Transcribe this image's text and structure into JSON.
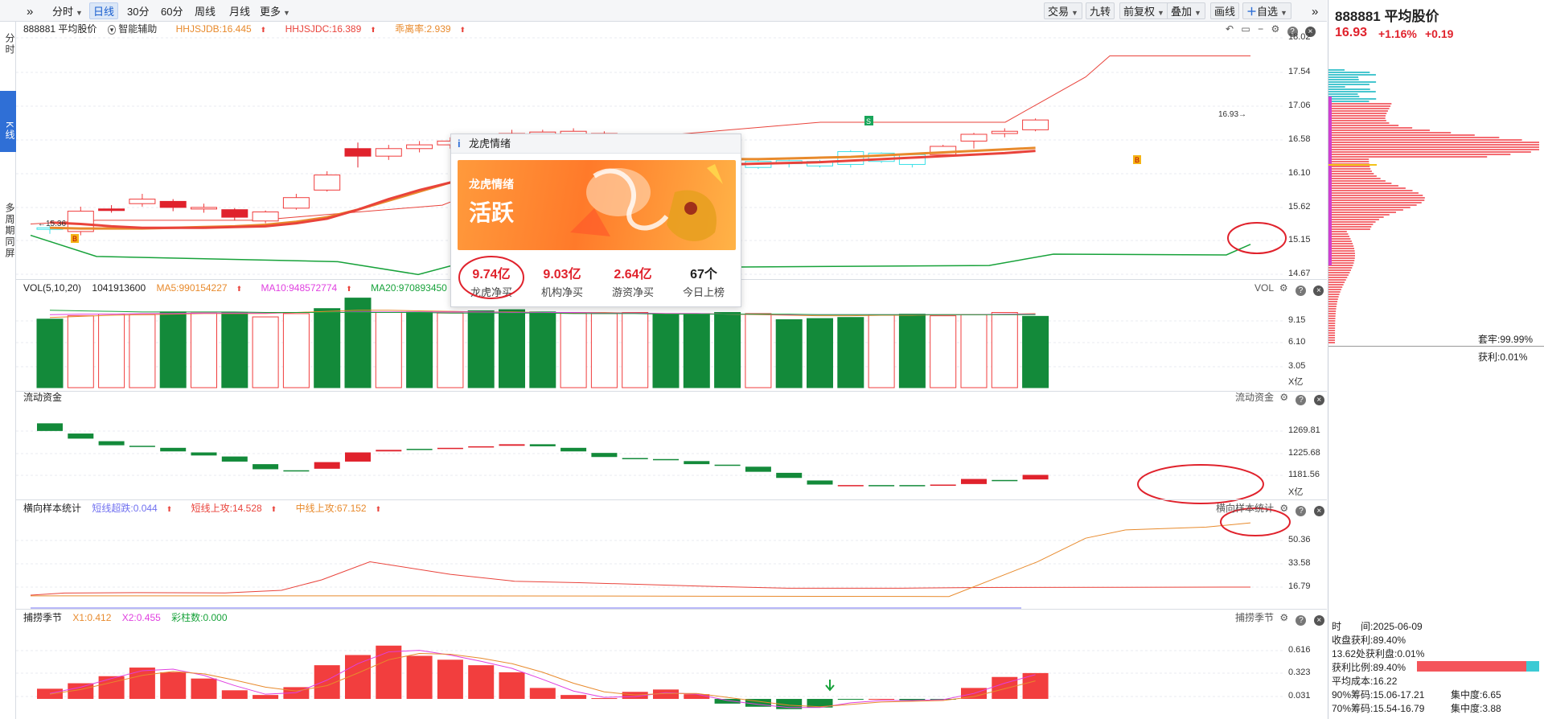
{
  "toolbar": {
    "expand_icon": "»",
    "items": [
      {
        "label": "分时",
        "dd": true
      },
      {
        "label": "日线",
        "active": true
      },
      {
        "label": "30分"
      },
      {
        "label": "60分"
      },
      {
        "label": "周线"
      },
      {
        "label": "月线"
      },
      {
        "label": "更多",
        "dd": true
      }
    ],
    "right_items": [
      {
        "label": "交易",
        "dd": true
      },
      {
        "label": "九转"
      },
      {
        "label": "前复权",
        "dd": true
      },
      {
        "label": "叠加",
        "dd": true
      },
      {
        "label": "画线"
      },
      {
        "label": "自选",
        "dd": true,
        "plus": true
      }
    ],
    "collapse_icon": "»"
  },
  "left_tabs": [
    {
      "label": "分时"
    },
    {
      "label": "K线",
      "active": true
    },
    {
      "label": "多周期同屏"
    }
  ],
  "kline": {
    "title": "888881 平均股价",
    "assist": "智能辅助",
    "ind1": "HHJSJDB:16.445",
    "ind2": "HHJSJDC:16.389",
    "ind3": "乖离率:2.939",
    "price_axis": [
      "18.02",
      "17.54",
      "17.06",
      "16.58",
      "16.10",
      "15.62",
      "15.15",
      "14.67"
    ],
    "low_label": "←15.36",
    "last_label": "16.93→",
    "marker_b": "B",
    "marker_s": "S"
  },
  "vol": {
    "title": "VOL(5,10,20)",
    "value": "1041913600",
    "ma5": "MA5:990154227",
    "ma10": "MA10:948572774",
    "ma20": "MA20:970893450",
    "right_label": "VOL",
    "axis": [
      "9.15",
      "6.10",
      "3.05",
      "X亿"
    ]
  },
  "flow": {
    "title": "流动资金",
    "right_label": "流动资金",
    "axis": [
      "1269.81",
      "1225.68",
      "1181.56",
      "X亿"
    ]
  },
  "sample": {
    "title": "横向样本统计",
    "s1": "短线超跌:0.044",
    "s2": "短线上攻:14.528",
    "s3": "中线上攻:67.152",
    "right_label": "横向样本统计",
    "axis": [
      "50.36",
      "33.58",
      "16.79"
    ]
  },
  "catch": {
    "title": "捕捞季节",
    "x1": "X1:0.412",
    "x2": "X2:0.455",
    "bars": "彩柱数:0.000",
    "right_label": "捕捞季节",
    "axis": [
      "0.616",
      "0.323",
      "0.031"
    ]
  },
  "popup": {
    "title": "龙虎情绪",
    "banner_small": "龙虎情绪",
    "banner_big": "活跃",
    "stats": [
      {
        "value": "9.74亿",
        "label": "龙虎净买"
      },
      {
        "value": "9.03亿",
        "label": "机构净买"
      },
      {
        "value": "2.64亿",
        "label": "游资净买"
      },
      {
        "value": "67个",
        "label": "今日上榜",
        "dark": true
      }
    ]
  },
  "right_panel": {
    "code_name": "888881 平均股价",
    "price": "16.93",
    "change_pct": "+1.16%",
    "change": "+0.19",
    "trap": "套牢:99.99%",
    "profit": "获利:0.01%",
    "date_label": "时　　间:2025-06-09",
    "close_profit": "收盘获利:89.40%",
    "profit_disc": "13.62处获利盘:0.01%",
    "profit_ratio": "获利比例:89.40%",
    "avg_cost": "平均成本:16.22",
    "chip90": "90%筹码:15.06-17.21",
    "conc90": "集中度:6.65",
    "chip70": "70%筹码:15.54-16.79",
    "conc70": "集中度:3.88"
  },
  "colors": {
    "up": "#f03c3c",
    "down": "#138a3a",
    "cyan": "#3ce0e8",
    "accent": "#2f6fd6"
  }
}
